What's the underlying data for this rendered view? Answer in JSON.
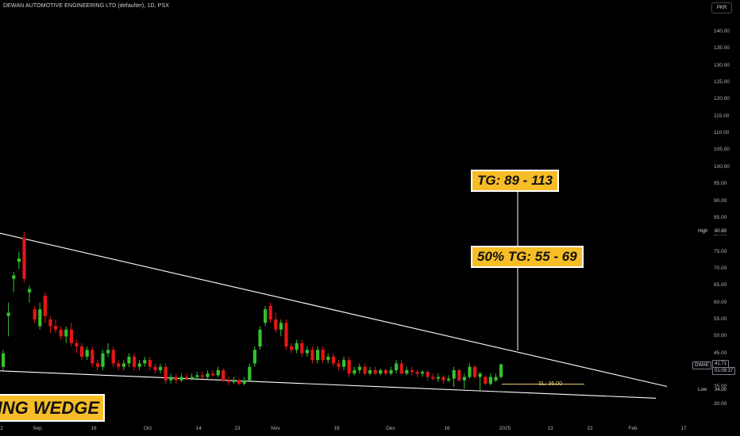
{
  "header": {
    "title": "DEWAN AUTOMOTIVE ENGINEERING LTD (defaulter), 1D, PSX",
    "currency": "PKR"
  },
  "colors": {
    "up": "#35c12f",
    "down": "#e51616",
    "trendline": "#ffffff",
    "annotation_bg": "#f7bd27",
    "background": "#000000"
  },
  "annotations": {
    "target": "TG: 89 - 113",
    "half_target": "50% TG: 55 - 69",
    "pattern": "LING WEDGE",
    "stop_loss": "SL: 36.00"
  },
  "price_scale": {
    "high_label": "High",
    "high_value": "80.89",
    "low_label": "Low",
    "low_value": "34.00",
    "symbol": "DWAE",
    "last_price": "41.71",
    "countdown": "01:09:37"
  },
  "chart_data": {
    "type": "candlestick",
    "title": "DEWAN AUTOMOTIVE ENGINEERING LTD (defaulter), 1D, PSX",
    "ylim": [
      30,
      145
    ],
    "y_ticks": [
      "140.00",
      "135.00",
      "130.00",
      "125.00",
      "120.00",
      "115.00",
      "110.00",
      "105.00",
      "100.00",
      "95.00",
      "90.00",
      "85.00",
      "80.00",
      "75.00",
      "70.00",
      "65.00",
      "60.00",
      "55.00",
      "50.00",
      "45.00",
      "40.00",
      "35.00",
      "30.00"
    ],
    "x_ticks": [
      "2",
      "Sep",
      "16",
      "Oct",
      "14",
      "23",
      "Nov",
      "18",
      "Dec",
      "16",
      "2025",
      "13",
      "22",
      "Feb",
      "17"
    ],
    "candles": [
      {
        "o": 41.0,
        "c": 45.0,
        "h": 46.0,
        "l": 40.0
      },
      {
        "o": 56.0,
        "c": 57.0,
        "h": 60.0,
        "l": 50.0
      },
      {
        "o": 67.0,
        "c": 68.0,
        "h": 69.0,
        "l": 63.0
      },
      {
        "o": 72.0,
        "c": 73.0,
        "h": 75.0,
        "l": 70.0
      },
      {
        "o": 79.0,
        "c": 67.0,
        "h": 80.9,
        "l": 66.0
      },
      {
        "o": 63.0,
        "c": 64.0,
        "h": 65.0,
        "l": 60.0
      },
      {
        "o": 58.0,
        "c": 55.0,
        "h": 59.0,
        "l": 54.0
      },
      {
        "o": 53.0,
        "c": 58.0,
        "h": 60.0,
        "l": 52.0
      },
      {
        "o": 62.0,
        "c": 56.0,
        "h": 63.0,
        "l": 54.0
      },
      {
        "o": 55.0,
        "c": 53.0,
        "h": 56.0,
        "l": 51.0
      },
      {
        "o": 53.0,
        "c": 52.0,
        "h": 55.0,
        "l": 51.0
      },
      {
        "o": 52.0,
        "c": 50.0,
        "h": 53.0,
        "l": 49.0
      },
      {
        "o": 50.0,
        "c": 52.0,
        "h": 53.0,
        "l": 48.0
      },
      {
        "o": 52.0,
        "c": 48.0,
        "h": 54.0,
        "l": 47.0
      },
      {
        "o": 48.0,
        "c": 47.0,
        "h": 49.0,
        "l": 45.0
      },
      {
        "o": 47.0,
        "c": 44.0,
        "h": 48.0,
        "l": 43.0
      },
      {
        "o": 44.0,
        "c": 46.0,
        "h": 47.0,
        "l": 43.0
      },
      {
        "o": 46.0,
        "c": 42.0,
        "h": 47.0,
        "l": 41.0
      },
      {
        "o": 42.0,
        "c": 41.0,
        "h": 43.0,
        "l": 40.0
      },
      {
        "o": 41.0,
        "c": 45.0,
        "h": 46.0,
        "l": 40.0
      },
      {
        "o": 45.0,
        "c": 46.0,
        "h": 48.0,
        "l": 44.0
      },
      {
        "o": 46.0,
        "c": 42.0,
        "h": 47.0,
        "l": 41.0
      },
      {
        "o": 42.0,
        "c": 41.0,
        "h": 43.0,
        "l": 40.0
      },
      {
        "o": 41.0,
        "c": 42.0,
        "h": 43.0,
        "l": 40.0
      },
      {
        "o": 42.0,
        "c": 44.0,
        "h": 45.0,
        "l": 41.0
      },
      {
        "o": 44.0,
        "c": 41.0,
        "h": 45.0,
        "l": 40.0
      },
      {
        "o": 41.0,
        "c": 42.0,
        "h": 43.0,
        "l": 40.0
      },
      {
        "o": 42.0,
        "c": 43.0,
        "h": 44.0,
        "l": 41.0
      },
      {
        "o": 43.0,
        "c": 41.0,
        "h": 44.0,
        "l": 40.0
      },
      {
        "o": 41.0,
        "c": 40.0,
        "h": 42.0,
        "l": 39.0
      },
      {
        "o": 40.0,
        "c": 41.0,
        "h": 42.0,
        "l": 39.0
      },
      {
        "o": 41.0,
        "c": 37.0,
        "h": 42.0,
        "l": 36.0
      },
      {
        "o": 37.0,
        "c": 38.0,
        "h": 39.0,
        "l": 36.0
      },
      {
        "o": 38.0,
        "c": 37.0,
        "h": 39.0,
        "l": 36.0
      },
      {
        "o": 37.0,
        "c": 38.0,
        "h": 39.0,
        "l": 36.5
      },
      {
        "o": 38.0,
        "c": 37.5,
        "h": 39.0,
        "l": 37.0
      },
      {
        "o": 37.5,
        "c": 38.0,
        "h": 39.0,
        "l": 37.0
      },
      {
        "o": 38.0,
        "c": 38.5,
        "h": 39.5,
        "l": 37.0
      },
      {
        "o": 38.5,
        "c": 38.0,
        "h": 39.5,
        "l": 37.5
      },
      {
        "o": 38.0,
        "c": 39.0,
        "h": 40.0,
        "l": 37.5
      },
      {
        "o": 39.0,
        "c": 38.5,
        "h": 40.0,
        "l": 38.0
      },
      {
        "o": 38.5,
        "c": 40.0,
        "h": 41.0,
        "l": 38.0
      },
      {
        "o": 40.0,
        "c": 37.0,
        "h": 40.5,
        "l": 36.5
      },
      {
        "o": 37.0,
        "c": 36.5,
        "h": 38.0,
        "l": 35.5
      },
      {
        "o": 36.5,
        "c": 37.0,
        "h": 38.0,
        "l": 36.0
      },
      {
        "o": 37.0,
        "c": 36.0,
        "h": 37.5,
        "l": 35.5
      },
      {
        "o": 36.0,
        "c": 37.0,
        "h": 38.0,
        "l": 35.5
      },
      {
        "o": 37.0,
        "c": 41.0,
        "h": 42.0,
        "l": 36.5
      },
      {
        "o": 42.0,
        "c": 46.0,
        "h": 47.0,
        "l": 41.0
      },
      {
        "o": 47.0,
        "c": 52.0,
        "h": 53.0,
        "l": 46.0
      },
      {
        "o": 54.0,
        "c": 58.0,
        "h": 59.0,
        "l": 53.0
      },
      {
        "o": 59.0,
        "c": 55.0,
        "h": 60.0,
        "l": 54.0
      },
      {
        "o": 55.0,
        "c": 52.0,
        "h": 57.0,
        "l": 51.0
      },
      {
        "o": 52.0,
        "c": 54.0,
        "h": 55.0,
        "l": 50.0
      },
      {
        "o": 54.0,
        "c": 47.0,
        "h": 55.0,
        "l": 46.0
      },
      {
        "o": 47.0,
        "c": 46.0,
        "h": 48.0,
        "l": 45.0
      },
      {
        "o": 46.0,
        "c": 48.0,
        "h": 49.0,
        "l": 45.0
      },
      {
        "o": 48.0,
        "c": 45.0,
        "h": 49.0,
        "l": 44.0
      },
      {
        "o": 45.0,
        "c": 46.0,
        "h": 47.0,
        "l": 44.0
      },
      {
        "o": 46.0,
        "c": 43.0,
        "h": 47.0,
        "l": 42.0
      },
      {
        "o": 43.0,
        "c": 46.0,
        "h": 47.0,
        "l": 42.0
      },
      {
        "o": 46.0,
        "c": 43.0,
        "h": 47.0,
        "l": 42.0
      },
      {
        "o": 43.0,
        "c": 44.0,
        "h": 45.0,
        "l": 42.0
      },
      {
        "o": 44.0,
        "c": 42.0,
        "h": 45.0,
        "l": 41.0
      },
      {
        "o": 42.0,
        "c": 41.0,
        "h": 43.0,
        "l": 40.0
      },
      {
        "o": 41.0,
        "c": 43.0,
        "h": 44.0,
        "l": 40.0
      },
      {
        "o": 43.0,
        "c": 39.0,
        "h": 44.0,
        "l": 38.0
      },
      {
        "o": 39.0,
        "c": 40.0,
        "h": 41.0,
        "l": 38.5
      },
      {
        "o": 40.0,
        "c": 41.0,
        "h": 42.0,
        "l": 39.0
      },
      {
        "o": 41.0,
        "c": 39.0,
        "h": 42.0,
        "l": 38.5
      },
      {
        "o": 39.0,
        "c": 40.0,
        "h": 41.0,
        "l": 38.5
      },
      {
        "o": 40.0,
        "c": 39.0,
        "h": 41.0,
        "l": 38.5
      },
      {
        "o": 39.0,
        "c": 40.0,
        "h": 40.5,
        "l": 38.5
      },
      {
        "o": 40.0,
        "c": 39.0,
        "h": 40.5,
        "l": 38.5
      },
      {
        "o": 39.0,
        "c": 40.0,
        "h": 41.0,
        "l": 38.5
      },
      {
        "o": 40.0,
        "c": 42.0,
        "h": 43.0,
        "l": 39.0
      },
      {
        "o": 42.0,
        "c": 39.0,
        "h": 43.0,
        "l": 38.5
      },
      {
        "o": 39.0,
        "c": 40.0,
        "h": 41.0,
        "l": 38.5
      },
      {
        "o": 40.0,
        "c": 39.5,
        "h": 41.0,
        "l": 38.5
      },
      {
        "o": 39.5,
        "c": 39.0,
        "h": 40.0,
        "l": 38.0
      },
      {
        "o": 39.0,
        "c": 39.5,
        "h": 40.0,
        "l": 38.0
      },
      {
        "o": 39.5,
        "c": 38.0,
        "h": 40.0,
        "l": 37.0
      },
      {
        "o": 38.0,
        "c": 37.5,
        "h": 39.0,
        "l": 37.0
      },
      {
        "o": 37.5,
        "c": 38.0,
        "h": 39.0,
        "l": 36.5
      },
      {
        "o": 38.0,
        "c": 37.0,
        "h": 38.5,
        "l": 36.0
      },
      {
        "o": 37.0,
        "c": 37.5,
        "h": 38.5,
        "l": 36.5
      },
      {
        "o": 37.5,
        "c": 40.0,
        "h": 41.0,
        "l": 35.0
      },
      {
        "o": 40.0,
        "c": 37.0,
        "h": 40.5,
        "l": 36.5
      },
      {
        "o": 37.0,
        "c": 38.0,
        "h": 39.0,
        "l": 34.5
      },
      {
        "o": 38.0,
        "c": 41.0,
        "h": 42.0,
        "l": 37.5
      },
      {
        "o": 41.0,
        "c": 38.0,
        "h": 41.5,
        "l": 37.5
      },
      {
        "o": 38.0,
        "c": 39.0,
        "h": 39.5,
        "l": 34.0
      },
      {
        "o": 38.0,
        "c": 36.0,
        "h": 38.5,
        "l": 35.5
      },
      {
        "o": 36.0,
        "c": 38.0,
        "h": 39.0,
        "l": 35.5
      },
      {
        "o": 37.0,
        "c": 38.0,
        "h": 39.0,
        "l": 36.5
      },
      {
        "o": 38.0,
        "c": 41.7,
        "h": 42.0,
        "l": 37.5
      }
    ],
    "trendlines": [
      {
        "name": "upper",
        "from": {
          "bar": 0,
          "price": 80.0
        },
        "to": {
          "bar": 114,
          "price": 35.2
        }
      },
      {
        "name": "lower",
        "from": {
          "bar": 0,
          "price": 39.8
        },
        "to": {
          "bar": 114,
          "price": 31.5
        }
      }
    ],
    "stop_loss": 36.0,
    "high": 80.89,
    "low": 34.0,
    "last": 41.71
  }
}
